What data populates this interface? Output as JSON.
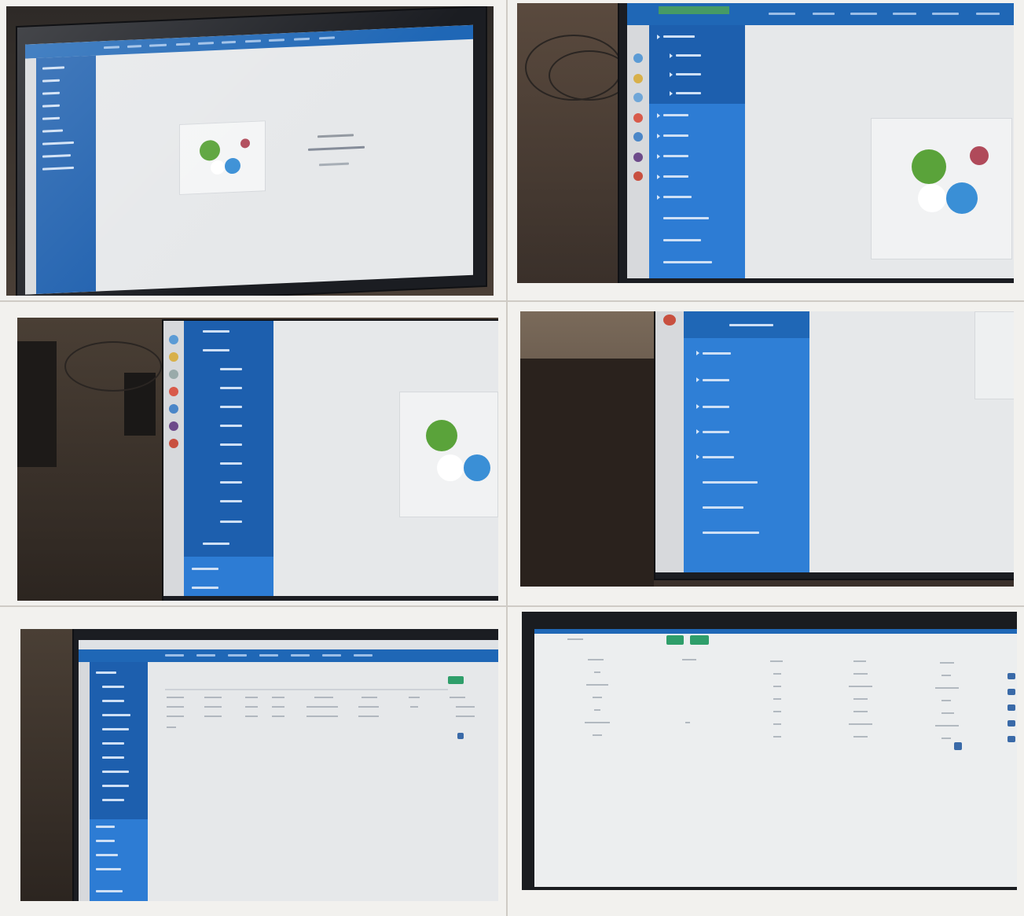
{
  "photos": [
    {
      "id": "p1",
      "view": "dashboard-home"
    },
    {
      "id": "p2",
      "view": "sidebar-home"
    },
    {
      "id": "p3",
      "view": "sidebar-expanded"
    },
    {
      "id": "p4",
      "view": "sidebar-zoom"
    },
    {
      "id": "p5",
      "view": "list-table"
    },
    {
      "id": "p6",
      "view": "detail-table"
    }
  ],
  "colors": {
    "accent": "#1f67b6",
    "sidebar": "#1d5fae",
    "screen": "#e6e8ea",
    "button": "#2f9e6a"
  }
}
